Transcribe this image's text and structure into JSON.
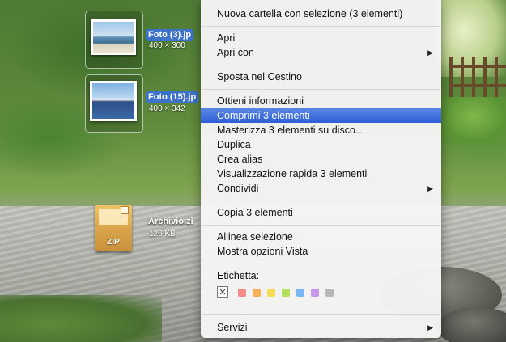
{
  "desktop": {
    "files": [
      {
        "name": "Foto (3).jp",
        "size": "400 × 300"
      },
      {
        "name": "Foto (15).jp",
        "size": "400 × 342"
      },
      {
        "name": "Archivio.zi",
        "size": "126 KB",
        "icon_label": "ZIP"
      }
    ]
  },
  "context_menu": {
    "items": [
      {
        "label": "Nuova cartella con selezione (3 elementi)"
      },
      {
        "label": "Apri"
      },
      {
        "label": "Apri con",
        "submenu": true
      },
      {
        "label": "Sposta nel Cestino"
      },
      {
        "label": "Ottieni informazioni"
      },
      {
        "label": "Comprimi 3 elementi",
        "highlighted": true
      },
      {
        "label": "Masterizza 3 elementi su disco…"
      },
      {
        "label": "Duplica"
      },
      {
        "label": "Crea alias"
      },
      {
        "label": "Visualizzazione rapida 3 elementi"
      },
      {
        "label": "Condividi",
        "submenu": true
      },
      {
        "label": "Copia 3 elementi"
      },
      {
        "label": "Allinea selezione"
      },
      {
        "label": "Mostra opzioni Vista"
      },
      {
        "label": "Servizi",
        "submenu": true
      }
    ],
    "label_section": {
      "heading": "Etichetta:",
      "none_symbol": "✕",
      "colors": [
        "#f28b8b",
        "#f4b25a",
        "#f2dd5a",
        "#b5e05a",
        "#7ab8f2",
        "#c29ae8",
        "#b8b8b8"
      ]
    },
    "submenu_arrow": "▶",
    "accent": "#3b6bdc"
  }
}
